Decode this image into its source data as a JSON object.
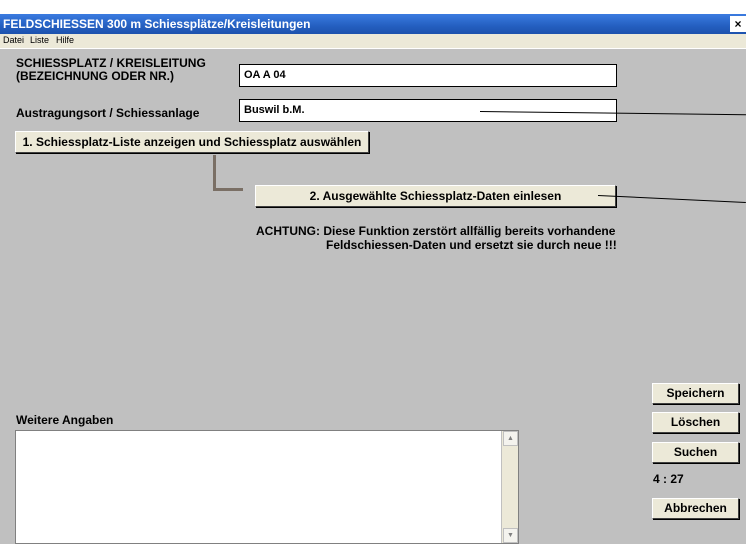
{
  "window": {
    "title": "FELDSCHIESSEN  300 m   Schiessplätze/Kreisleitungen",
    "close_label": "×"
  },
  "menu": {
    "items": [
      "Datei",
      "Liste",
      "Hilfe"
    ]
  },
  "form": {
    "schiessplatz_label_line1": "SCHIESSPLATZ / KREISLEITUNG",
    "schiessplatz_label_line2": "(BEZEICHNUNG ODER NR.)",
    "schiessplatz_value": "OA A 04",
    "austragungsort_label": "Austragungsort / Schiessanlage",
    "austragungsort_value": "Buswil b.M.",
    "button_list": "1.  Schiessplatz-Liste anzeigen und Schiessplatz auswählen",
    "button_read": "2.  Ausgewählte Schiessplatz-Daten einlesen",
    "warning_line1": "ACHTUNG: Diese Funktion zerstört allfällig bereits vorhandene",
    "warning_line2": "Feldschiessen-Daten und ersetzt sie durch neue !!!",
    "weitere_label": "Weitere Angaben",
    "weitere_value": ""
  },
  "actions": {
    "save": "Speichern",
    "delete": "Löschen",
    "search": "Suchen",
    "counter": "4 : 27",
    "cancel": "Abbrechen"
  },
  "icons": {
    "scroll_up": "▲",
    "scroll_down": "▼"
  }
}
